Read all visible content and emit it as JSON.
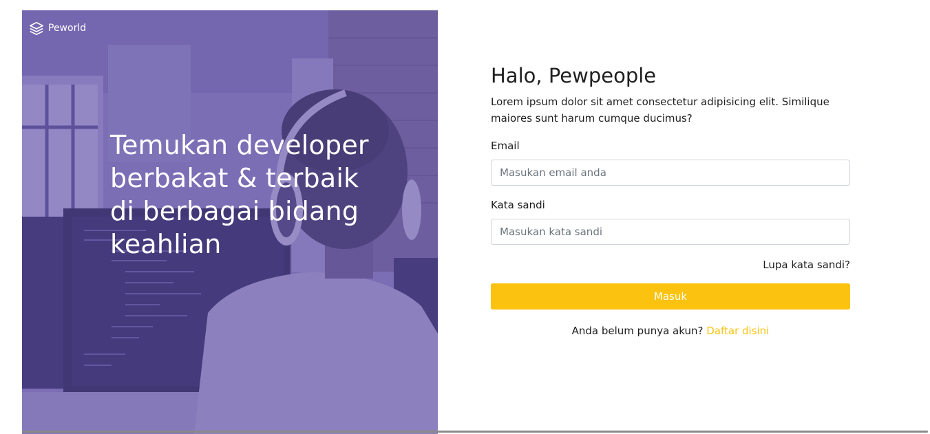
{
  "colors": {
    "accent": "#fbc30f",
    "hero_overlay": "#5e50a1",
    "text": "#1f1f1f"
  },
  "hero": {
    "brand_name": "Peworld",
    "brand_icon": "layers-icon",
    "headline": "Temukan developer berbakat & terbaik di berbagai bidang keahlian",
    "image": "developer-with-headphones-coding-photo"
  },
  "form": {
    "title": "Halo, Pewpeople",
    "subtitle": "Lorem ipsum dolor sit amet consectetur adipisicing elit. Similique maiores sunt harum cumque ducimus?",
    "email_label": "Email",
    "email_placeholder": "Masukan email anda",
    "password_label": "Kata sandi",
    "password_placeholder": "Masukan kata sandi",
    "forgot_label": "Lupa kata sandi?",
    "submit_label": "Masuk",
    "register_prompt": "Anda belum punya akun?",
    "register_link": "Daftar disini"
  }
}
